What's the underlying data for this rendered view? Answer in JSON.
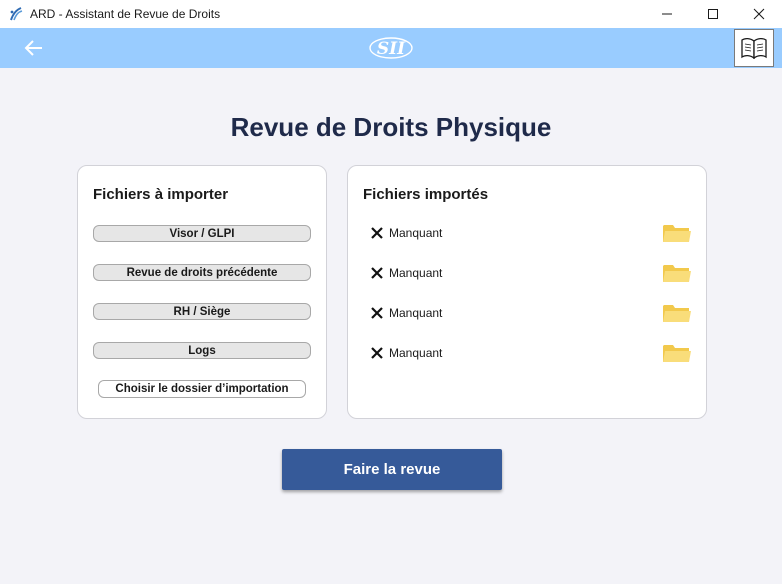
{
  "window": {
    "title": "ARD - Assistant de Revue de Droits"
  },
  "header": {
    "logo_text": "SII",
    "back_icon": "arrow-left-icon",
    "help_icon": "book-icon"
  },
  "main": {
    "title": "Revue de Droits Physique",
    "import_card": {
      "heading": "Fichiers à importer",
      "buttons": [
        "Visor / GLPI",
        "Revue de droits précédente",
        "RH / Siège",
        "Logs"
      ],
      "choose_folder_label": "Choisir le dossier d’importation"
    },
    "imported_card": {
      "heading": "Fichiers importés",
      "files": [
        {
          "status": "Manquant"
        },
        {
          "status": "Manquant"
        },
        {
          "status": "Manquant"
        },
        {
          "status": "Manquant"
        }
      ]
    },
    "review_button": "Faire la revue"
  },
  "colors": {
    "header_bg": "#99ccff",
    "primary_button": "#365a99",
    "title_text": "#1f2a4a",
    "folder": "#f7d46a"
  }
}
